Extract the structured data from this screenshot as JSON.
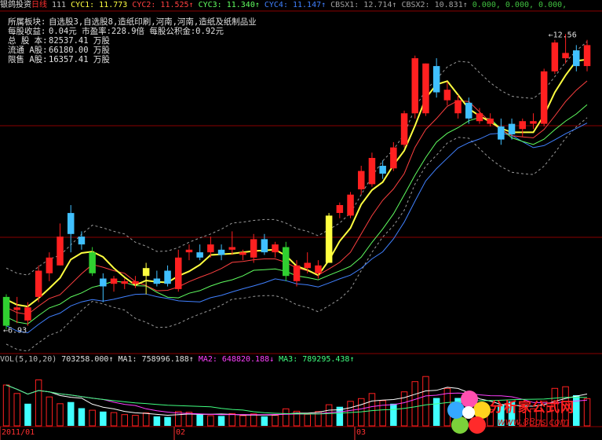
{
  "header": {
    "stock_name": "银鸽投资",
    "period": "日线",
    "indicators": [
      {
        "label": "111",
        "color": "#c0c0c0"
      },
      {
        "label": "CYC1: 11.773",
        "color": "#ffff40"
      },
      {
        "label": "CYC2: 11.525↑",
        "color": "#ff4040"
      },
      {
        "label": "CYC3: 11.340↑",
        "color": "#60ff60"
      },
      {
        "label": "CYC4: 11.147↑",
        "color": "#4080ff"
      },
      {
        "label": "CBSX1: 12.714↑",
        "color": "#a0a0a0"
      },
      {
        "label": "CBSX2: 10.831↑",
        "color": "#a0a0a0"
      },
      {
        "label": "0.000, 0.000, 0.000,",
        "color": "#40c040"
      }
    ]
  },
  "info": [
    {
      "label": "所属板块:",
      "value": "自选股3,自选股8,造纸印刷,河南,河南,造纸及纸制品业"
    },
    {
      "label": "每股收益:",
      "value": "0.04元   市盈率:228.9倍   每股公积金:0.92元"
    },
    {
      "label": "总 股 本:",
      "value": "82537.41  万股"
    },
    {
      "label": "流通 A股:",
      "value": "66180.00  万股"
    },
    {
      "label": "限售 A股:",
      "value": "16357.41  万股"
    }
  ],
  "price_annotations": {
    "high": "12.56",
    "low": "6.93"
  },
  "volume_header": [
    {
      "label": "VOL(5,10,20)",
      "color": "#c0c0c0"
    },
    {
      "label": "703258.000↑",
      "color": "#e0e0e0"
    },
    {
      "label": "MA1: 758996.188↑",
      "color": "#e0e0e0"
    },
    {
      "label": "MA2: 648820.188↓",
      "color": "#ff40ff"
    },
    {
      "label": "MA3: 789295.438↑",
      "color": "#40ff80"
    }
  ],
  "dates": [
    {
      "label": "2011/01"
    },
    {
      "label": "02"
    },
    {
      "label": "03"
    }
  ],
  "watermark": {
    "title": "分析家公式网",
    "url": "www.88gs.com"
  },
  "colors": {
    "up": "#ff2020",
    "down": "#40c0ff",
    "yellow": "#ffff40",
    "green": "#30d030",
    "grid": "#8a0000"
  },
  "chart_data": {
    "type": "candlestick",
    "price_range": [
      6.5,
      13.0
    ],
    "candles": [
      {
        "o": 7.0,
        "h": 7.6,
        "l": 6.93,
        "c": 7.55,
        "color": "green"
      },
      {
        "o": 7.3,
        "h": 7.55,
        "l": 7.05,
        "c": 7.35,
        "color": "up"
      },
      {
        "o": 7.1,
        "h": 7.45,
        "l": 7.0,
        "c": 7.35,
        "color": "up"
      },
      {
        "o": 7.55,
        "h": 8.15,
        "l": 7.45,
        "c": 8.05,
        "color": "up"
      },
      {
        "o": 8.0,
        "h": 8.4,
        "l": 7.85,
        "c": 8.3,
        "color": "up"
      },
      {
        "o": 8.7,
        "h": 8.95,
        "l": 8.15,
        "c": 8.15,
        "color": "up"
      },
      {
        "o": 9.15,
        "h": 9.3,
        "l": 8.4,
        "c": 8.75,
        "color": "down"
      },
      {
        "o": 8.7,
        "h": 8.8,
        "l": 8.45,
        "c": 8.55,
        "color": "down"
      },
      {
        "o": 8.0,
        "h": 8.5,
        "l": 7.95,
        "c": 8.4,
        "color": "green"
      },
      {
        "o": 7.9,
        "h": 8.0,
        "l": 7.45,
        "c": 7.75,
        "color": "down"
      },
      {
        "o": 7.8,
        "h": 7.95,
        "l": 7.65,
        "c": 7.9,
        "color": "up"
      },
      {
        "o": 7.8,
        "h": 7.9,
        "l": 7.7,
        "c": 7.85,
        "color": "up"
      },
      {
        "o": 7.85,
        "h": 7.95,
        "l": 7.72,
        "c": 7.8,
        "color": "up"
      },
      {
        "o": 7.95,
        "h": 8.2,
        "l": 7.6,
        "c": 8.1,
        "color": "yellow"
      },
      {
        "o": 7.9,
        "h": 8.05,
        "l": 7.75,
        "c": 7.8,
        "color": "down"
      },
      {
        "o": 8.05,
        "h": 8.15,
        "l": 7.75,
        "c": 7.8,
        "color": "down"
      },
      {
        "o": 7.7,
        "h": 8.45,
        "l": 7.65,
        "c": 8.3,
        "color": "up"
      },
      {
        "o": 8.4,
        "h": 8.55,
        "l": 8.25,
        "c": 8.45,
        "color": "up"
      },
      {
        "o": 8.4,
        "h": 8.55,
        "l": 8.25,
        "c": 8.3,
        "color": "down"
      },
      {
        "o": 8.4,
        "h": 8.7,
        "l": 8.3,
        "c": 8.55,
        "color": "up"
      },
      {
        "o": 8.45,
        "h": 8.55,
        "l": 8.25,
        "c": 8.35,
        "color": "down"
      },
      {
        "o": 8.45,
        "h": 8.8,
        "l": 8.35,
        "c": 8.5,
        "color": "up"
      },
      {
        "o": 8.35,
        "h": 8.45,
        "l": 8.25,
        "c": 8.4,
        "color": "up"
      },
      {
        "o": 8.3,
        "h": 8.75,
        "l": 8.2,
        "c": 8.65,
        "color": "up"
      },
      {
        "o": 8.65,
        "h": 8.75,
        "l": 8.35,
        "c": 8.4,
        "color": "down"
      },
      {
        "o": 8.4,
        "h": 8.6,
        "l": 8.3,
        "c": 8.55,
        "color": "up"
      },
      {
        "o": 8.5,
        "h": 8.6,
        "l": 7.85,
        "c": 7.95,
        "color": "green"
      },
      {
        "o": 8.15,
        "h": 8.25,
        "l": 7.75,
        "c": 7.85,
        "color": "up"
      },
      {
        "o": 8.2,
        "h": 8.4,
        "l": 8.0,
        "c": 8.1,
        "color": "up"
      },
      {
        "o": 8.0,
        "h": 8.25,
        "l": 7.9,
        "c": 8.15,
        "color": "up"
      },
      {
        "o": 8.2,
        "h": 9.15,
        "l": 8.2,
        "c": 9.1,
        "color": "yellow"
      },
      {
        "o": 9.15,
        "h": 9.35,
        "l": 9.05,
        "c": 9.3,
        "color": "up"
      },
      {
        "o": 9.5,
        "h": 9.55,
        "l": 9.05,
        "c": 9.1,
        "color": "up"
      },
      {
        "o": 9.6,
        "h": 10.05,
        "l": 9.5,
        "c": 9.95,
        "color": "up"
      },
      {
        "o": 9.7,
        "h": 10.3,
        "l": 9.65,
        "c": 10.2,
        "color": "up"
      },
      {
        "o": 10.05,
        "h": 10.15,
        "l": 9.8,
        "c": 9.9,
        "color": "down"
      },
      {
        "o": 10.0,
        "h": 10.5,
        "l": 9.95,
        "c": 10.4,
        "color": "up"
      },
      {
        "o": 10.45,
        "h": 11.1,
        "l": 10.4,
        "c": 11.05,
        "color": "up"
      },
      {
        "o": 11.05,
        "h": 12.15,
        "l": 10.95,
        "c": 12.1,
        "color": "up"
      },
      {
        "o": 11.05,
        "h": 12.0,
        "l": 11.0,
        "c": 12.0,
        "color": "up"
      },
      {
        "o": 11.95,
        "h": 12.1,
        "l": 11.35,
        "c": 11.45,
        "color": "down"
      },
      {
        "o": 11.5,
        "h": 11.65,
        "l": 11.2,
        "c": 11.3,
        "color": "up"
      },
      {
        "o": 11.3,
        "h": 11.4,
        "l": 10.95,
        "c": 11.05,
        "color": "up"
      },
      {
        "o": 11.25,
        "h": 11.35,
        "l": 10.85,
        "c": 10.95,
        "color": "down"
      },
      {
        "o": 11.05,
        "h": 11.15,
        "l": 10.85,
        "c": 10.9,
        "color": "up"
      },
      {
        "o": 10.95,
        "h": 11.05,
        "l": 10.8,
        "c": 10.85,
        "color": "up"
      },
      {
        "o": 10.8,
        "h": 10.95,
        "l": 10.45,
        "c": 10.55,
        "color": "down"
      },
      {
        "o": 10.85,
        "h": 10.95,
        "l": 10.55,
        "c": 10.65,
        "color": "down"
      },
      {
        "o": 10.75,
        "h": 10.95,
        "l": 10.6,
        "c": 10.9,
        "color": "up"
      },
      {
        "o": 10.9,
        "h": 11.05,
        "l": 10.75,
        "c": 10.85,
        "color": "up"
      },
      {
        "o": 10.85,
        "h": 11.9,
        "l": 10.8,
        "c": 11.85,
        "color": "up"
      },
      {
        "o": 11.85,
        "h": 12.45,
        "l": 11.8,
        "c": 12.4,
        "color": "up"
      },
      {
        "o": 12.1,
        "h": 12.56,
        "l": 12.0,
        "c": 12.2,
        "color": "up"
      },
      {
        "o": 12.25,
        "h": 12.35,
        "l": 11.85,
        "c": 11.95,
        "color": "down"
      },
      {
        "o": 12.35,
        "h": 12.45,
        "l": 11.85,
        "c": 11.95,
        "color": "up"
      }
    ],
    "volume_range": [
      0,
      1800000
    ],
    "volume": [
      {
        "v": 1200000,
        "color": "up"
      },
      {
        "v": 950000,
        "color": "up"
      },
      {
        "v": 650000,
        "color": "down"
      },
      {
        "v": 1350000,
        "color": "up"
      },
      {
        "v": 850000,
        "color": "up"
      },
      {
        "v": 650000,
        "color": "up"
      },
      {
        "v": 700000,
        "color": "down"
      },
      {
        "v": 520000,
        "color": "down"
      },
      {
        "v": 460000,
        "color": "up"
      },
      {
        "v": 420000,
        "color": "down"
      },
      {
        "v": 390000,
        "color": "up"
      },
      {
        "v": 330000,
        "color": "up"
      },
      {
        "v": 310000,
        "color": "up"
      },
      {
        "v": 380000,
        "color": "up"
      },
      {
        "v": 280000,
        "color": "down"
      },
      {
        "v": 260000,
        "color": "down"
      },
      {
        "v": 420000,
        "color": "up"
      },
      {
        "v": 400000,
        "color": "up"
      },
      {
        "v": 330000,
        "color": "down"
      },
      {
        "v": 300000,
        "color": "up"
      },
      {
        "v": 290000,
        "color": "down"
      },
      {
        "v": 360000,
        "color": "up"
      },
      {
        "v": 300000,
        "color": "up"
      },
      {
        "v": 350000,
        "color": "up"
      },
      {
        "v": 280000,
        "color": "down"
      },
      {
        "v": 310000,
        "color": "up"
      },
      {
        "v": 500000,
        "color": "up"
      },
      {
        "v": 430000,
        "color": "up"
      },
      {
        "v": 340000,
        "color": "up"
      },
      {
        "v": 420000,
        "color": "up"
      },
      {
        "v": 620000,
        "color": "up"
      },
      {
        "v": 560000,
        "color": "down"
      },
      {
        "v": 720000,
        "color": "up"
      },
      {
        "v": 800000,
        "color": "up"
      },
      {
        "v": 950000,
        "color": "up"
      },
      {
        "v": 740000,
        "color": "up"
      },
      {
        "v": 650000,
        "color": "down"
      },
      {
        "v": 1000000,
        "color": "up"
      },
      {
        "v": 1300000,
        "color": "up"
      },
      {
        "v": 1450000,
        "color": "up"
      },
      {
        "v": 820000,
        "color": "down"
      },
      {
        "v": 1100000,
        "color": "up"
      },
      {
        "v": 820000,
        "color": "down"
      },
      {
        "v": 680000,
        "color": "up"
      },
      {
        "v": 550000,
        "color": "down"
      },
      {
        "v": 480000,
        "color": "up"
      },
      {
        "v": 620000,
        "color": "down"
      },
      {
        "v": 720000,
        "color": "down"
      },
      {
        "v": 560000,
        "color": "up"
      },
      {
        "v": 500000,
        "color": "up"
      },
      {
        "v": 720000,
        "color": "up"
      },
      {
        "v": 1100000,
        "color": "up"
      },
      {
        "v": 1150000,
        "color": "up"
      },
      {
        "v": 900000,
        "color": "down"
      },
      {
        "v": 800000,
        "color": "up"
      }
    ],
    "ma_lines": {
      "yellow": "CYC1",
      "red": "CYC2",
      "green": "CYC3",
      "blue": "CYC4"
    }
  }
}
